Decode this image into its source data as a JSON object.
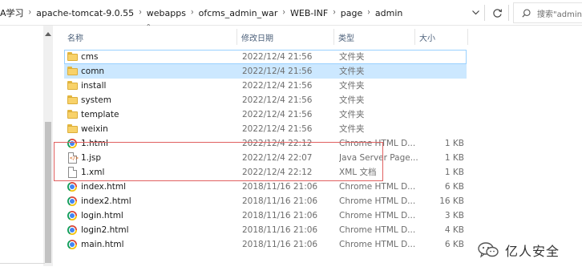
{
  "address": {
    "crumbs": [
      "A学习",
      "apache-tomcat-9.0.55",
      "webapps",
      "ofcms_admin_war",
      "WEB-INF",
      "page",
      "admin"
    ],
    "separator": "›"
  },
  "search": {
    "placeholder": "搜索\"admin\""
  },
  "columns": {
    "name": "名称",
    "date": "修改日期",
    "type": "类型",
    "size": "大小"
  },
  "files": [
    {
      "icon": "folder-icon",
      "name": "cms",
      "date": "2022/12/4 21:56",
      "type": "文件夹",
      "size": "",
      "state": "focus"
    },
    {
      "icon": "folder-icon",
      "name": "comn",
      "date": "2022/12/4 21:56",
      "type": "文件夹",
      "size": "",
      "state": "selected"
    },
    {
      "icon": "folder-icon",
      "name": "install",
      "date": "2022/12/4 21:56",
      "type": "文件夹",
      "size": "",
      "state": ""
    },
    {
      "icon": "folder-icon",
      "name": "system",
      "date": "2022/12/4 21:56",
      "type": "文件夹",
      "size": "",
      "state": ""
    },
    {
      "icon": "folder-icon",
      "name": "template",
      "date": "2022/12/4 21:56",
      "type": "文件夹",
      "size": "",
      "state": ""
    },
    {
      "icon": "folder-icon",
      "name": "weixin",
      "date": "2022/12/4 21:56",
      "type": "文件夹",
      "size": "",
      "state": ""
    },
    {
      "icon": "chrome-icon",
      "name": "1.html",
      "date": "2022/12/4 22:12",
      "type": "Chrome HTML D...",
      "size": "1 KB",
      "state": ""
    },
    {
      "icon": "jsp-file-icon",
      "name": "1.jsp",
      "date": "2022/12/4 22:07",
      "type": "Java Server Page...",
      "size": "1 KB",
      "state": ""
    },
    {
      "icon": "xml-file-icon",
      "name": "1.xml",
      "date": "2022/12/4 22:12",
      "type": "XML 文档",
      "size": "1 KB",
      "state": ""
    },
    {
      "icon": "chrome-icon",
      "name": "index.html",
      "date": "2018/11/16 21:06",
      "type": "Chrome HTML D...",
      "size": "6 KB",
      "state": ""
    },
    {
      "icon": "chrome-icon",
      "name": "index2.html",
      "date": "2018/11/16 21:06",
      "type": "Chrome HTML D...",
      "size": "16 KB",
      "state": ""
    },
    {
      "icon": "chrome-icon",
      "name": "login.html",
      "date": "2018/11/16 21:06",
      "type": "Chrome HTML D...",
      "size": "3 KB",
      "state": ""
    },
    {
      "icon": "chrome-icon",
      "name": "login2.html",
      "date": "2018/11/16 21:06",
      "type": "Chrome HTML D...",
      "size": "4 KB",
      "state": ""
    },
    {
      "icon": "chrome-icon",
      "name": "main.html",
      "date": "2018/11/16 21:06",
      "type": "Chrome HTML D...",
      "size": "6 KB",
      "state": ""
    }
  ],
  "watermark": {
    "text": "亿人安全",
    "logo": "wechat-logo"
  },
  "colors": {
    "selection": "#cce8ff",
    "focus_border": "#99d1ff",
    "highlight_box": "#e06060",
    "header_text": "#4c607a"
  }
}
